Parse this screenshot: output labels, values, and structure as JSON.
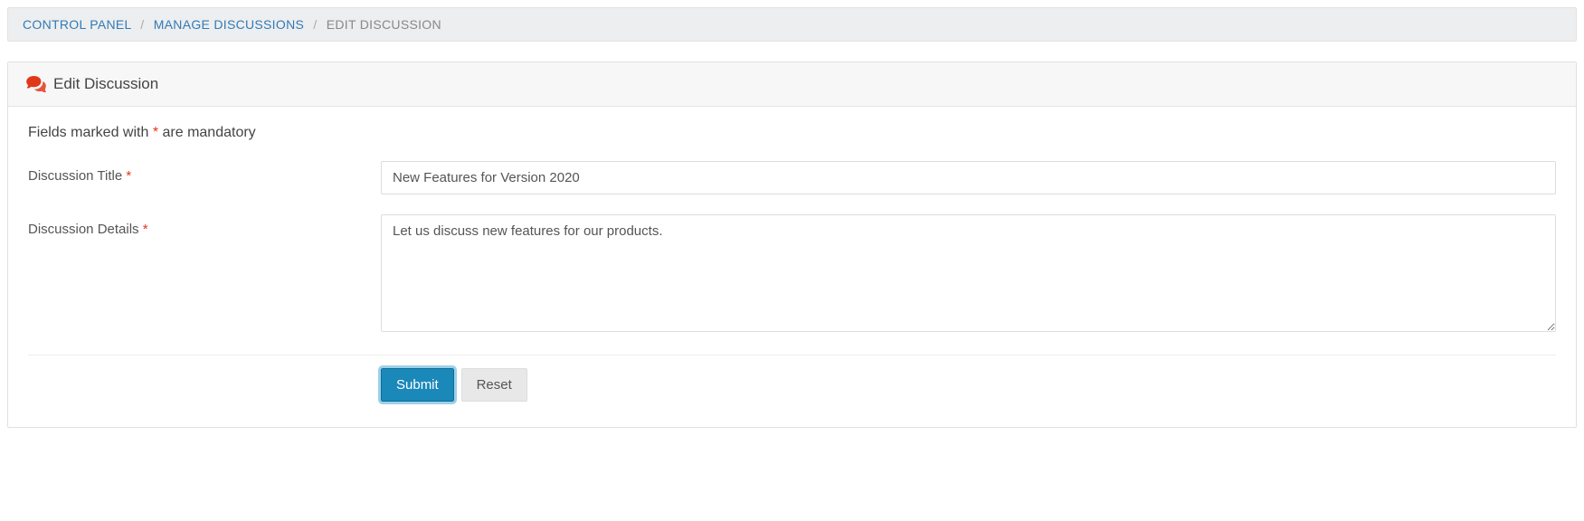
{
  "breadcrumb": {
    "items": [
      {
        "label": "CONTROL PANEL",
        "link": true
      },
      {
        "label": "MANAGE DISCUSSIONS",
        "link": true
      },
      {
        "label": "EDIT DISCUSSION",
        "link": false
      }
    ],
    "sep": "/"
  },
  "panel": {
    "title": "Edit Discussion"
  },
  "form": {
    "mandatory_note_pre": "Fields marked with ",
    "mandatory_note_star": "*",
    "mandatory_note_post": " are mandatory",
    "title_label": "Discussion Title ",
    "title_value": "New Features for Version 2020",
    "details_label": "Discussion Details ",
    "details_value": "Let us discuss new features for our products.",
    "asterisk": "*"
  },
  "actions": {
    "submit": "Submit",
    "reset": "Reset"
  }
}
